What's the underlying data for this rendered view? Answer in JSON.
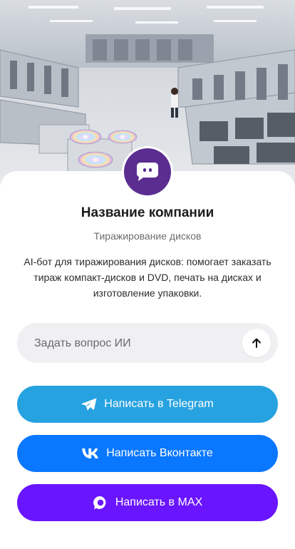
{
  "company": {
    "name": "Название компании",
    "category": "Тиражирование дисков",
    "description": "AI-бот для тиражирования дисков: помогает заказать тираж компакт-дисков и DVD, печать на дисках и изготовление упаковки."
  },
  "ask": {
    "placeholder": "Задать вопрос ИИ",
    "send_icon": "arrow-up-icon"
  },
  "buttons": {
    "telegram": {
      "label": "Написать в Telegram",
      "icon": "telegram-icon",
      "color": "#27a2e0"
    },
    "vk": {
      "label": "Написать Вконтакте",
      "icon": "vk-icon",
      "color": "#0a77ff"
    },
    "max": {
      "label": "Написать в MAX",
      "icon": "max-icon",
      "color": "#6a15ff"
    }
  },
  "colors": {
    "avatar": "#5b2d91"
  }
}
